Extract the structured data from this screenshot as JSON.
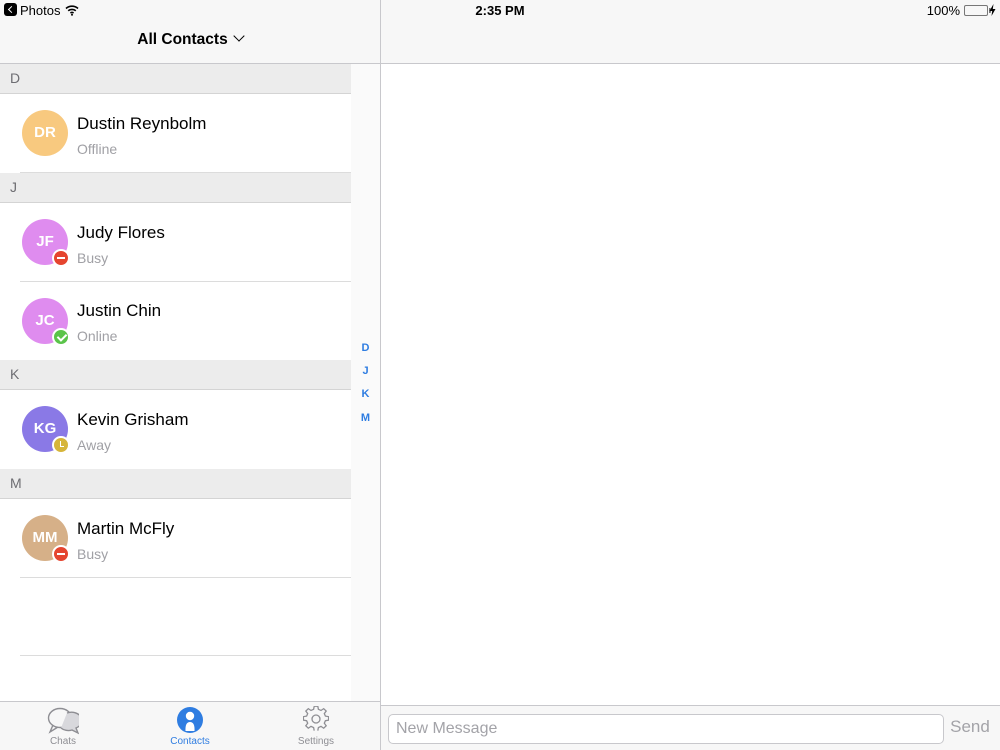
{
  "status_bar": {
    "app_name": "Photos",
    "time": "2:35 PM",
    "battery_percent": "100%",
    "icons": [
      "back-icon",
      "wifi-icon",
      "battery-icon",
      "charging-icon"
    ]
  },
  "nav": {
    "title": "All Contacts",
    "title_icon": "chevron-down-icon"
  },
  "contacts": {
    "sections": [
      {
        "letter": "D",
        "items": [
          {
            "initials": "DR",
            "name": "Dustin Reynbolm",
            "status": "Offline",
            "avatar_color": "#f8c97f",
            "presence": "none"
          }
        ]
      },
      {
        "letter": "J",
        "items": [
          {
            "initials": "JF",
            "name": "Judy Flores",
            "status": "Busy",
            "avatar_color": "#df8cef",
            "presence": "busy"
          },
          {
            "initials": "JC",
            "name": "Justin Chin",
            "status": "Online",
            "avatar_color": "#df8cef",
            "presence": "online"
          }
        ]
      },
      {
        "letter": "K",
        "items": [
          {
            "initials": "KG",
            "name": "Kevin Grisham",
            "status": "Away",
            "avatar_color": "#8a79e6",
            "presence": "away"
          }
        ]
      },
      {
        "letter": "M",
        "items": [
          {
            "initials": "MM",
            "name": "Martin McFly",
            "status": "Busy",
            "avatar_color": "#d6b088",
            "presence": "busy"
          }
        ]
      }
    ]
  },
  "index": [
    "D",
    "J",
    "K",
    "M"
  ],
  "tabs": [
    {
      "label": "Chats",
      "icon": "chat-bubbles-icon",
      "active": false
    },
    {
      "label": "Contacts",
      "icon": "person-icon",
      "active": true
    },
    {
      "label": "Settings",
      "icon": "gear-icon",
      "active": false
    }
  ],
  "composer": {
    "placeholder": "New Message",
    "value": "",
    "send_label": "Send"
  },
  "colors": {
    "accent": "#2f7de1",
    "busy": "#e5452f",
    "online": "#5bc44a",
    "away": "#d6b53a"
  }
}
